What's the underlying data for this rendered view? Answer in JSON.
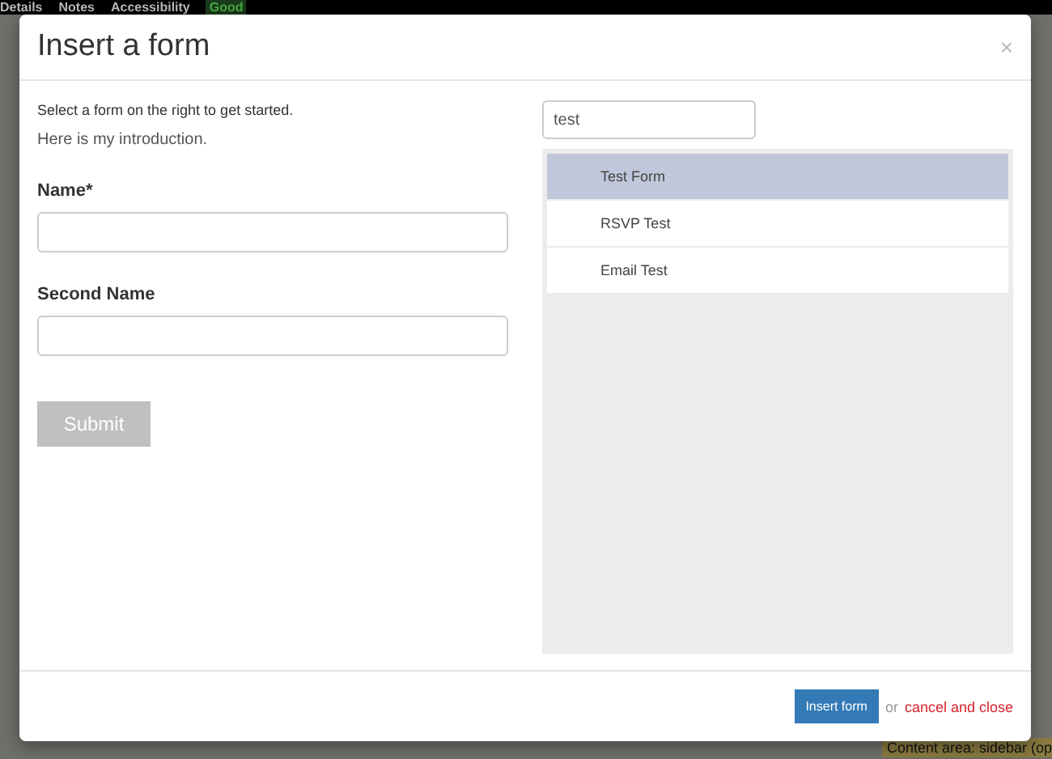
{
  "background_page": {
    "top_bar": [
      {
        "label": "Details",
        "kind": "link"
      },
      {
        "label": "Notes",
        "kind": "link"
      },
      {
        "label": "Accessibility",
        "kind": "link"
      },
      {
        "label": "Good",
        "kind": "badge"
      }
    ],
    "sidebar_label": "Content area: sidebar (op"
  },
  "modal": {
    "title": "Insert a form",
    "close": "×",
    "intro": "Select a form on the right to get started.",
    "preview": {
      "introduction": "Here is my introduction.",
      "fields": [
        {
          "label": "Name*"
        },
        {
          "label": "Second Name"
        }
      ],
      "submit": {
        "label": "Submit",
        "disabled": true
      }
    },
    "search": {
      "value": "test"
    },
    "forms": [
      {
        "label": "Test Form",
        "selected": true
      },
      {
        "label": "RSVP Test",
        "selected": false
      },
      {
        "label": "Email Test",
        "selected": false
      }
    ],
    "footer": {
      "insert": "Insert form",
      "or": "or",
      "cancel": "cancel and close"
    }
  }
}
